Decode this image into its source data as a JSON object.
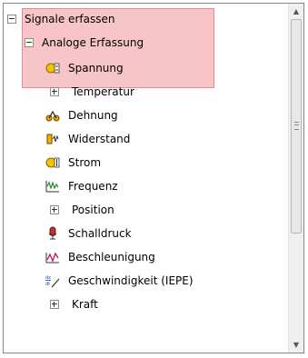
{
  "tree": {
    "root": {
      "label": "Signale erfassen",
      "expanded": true,
      "icon": "minus-expander"
    },
    "group": {
      "label": "Analoge Erfassung",
      "expanded": true,
      "icon": "minus-expander"
    },
    "items": [
      {
        "label": "Spannung",
        "icon": "voltage-icon",
        "selected": true
      },
      {
        "label": "Temperatur",
        "icon": "plus-expander"
      },
      {
        "label": "Dehnung",
        "icon": "strain-icon"
      },
      {
        "label": "Widerstand",
        "icon": "resistor-icon"
      },
      {
        "label": "Strom",
        "icon": "current-icon"
      },
      {
        "label": "Frequenz",
        "icon": "frequency-icon"
      },
      {
        "label": "Position",
        "icon": "plus-expander"
      },
      {
        "label": "Schalldruck",
        "icon": "microphone-icon"
      },
      {
        "label": "Beschleunigung",
        "icon": "acceleration-icon"
      },
      {
        "label": "Geschwindigkeit (IEPE)",
        "icon": "velocity-icon"
      },
      {
        "label": "Kraft",
        "icon": "plus-expander"
      }
    ]
  },
  "colors": {
    "highlight_fill": "#f7c5c7",
    "highlight_border": "#e58a8f",
    "panel_border": "#828790"
  },
  "scrollbar": {
    "up_arrow": "▲",
    "down_arrow": "▼"
  }
}
